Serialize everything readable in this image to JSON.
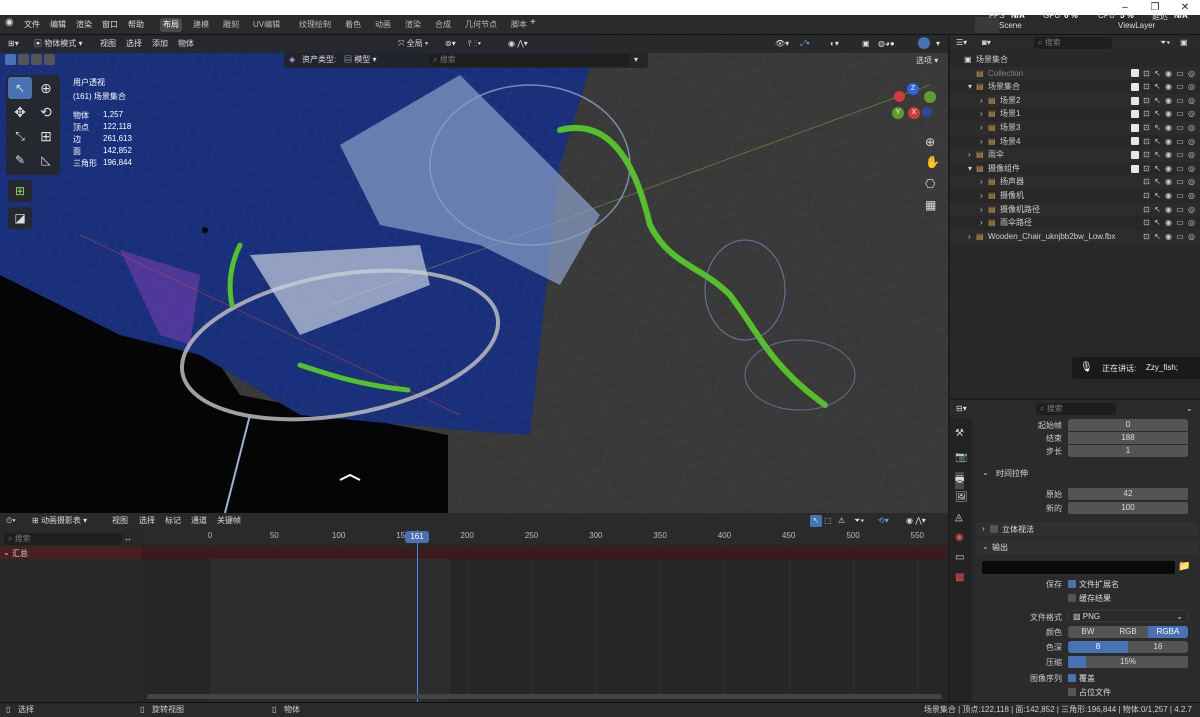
{
  "os_bar": {
    "logo_icon": "blender-logo-icon",
    "menus": [
      "文件",
      "编辑",
      "渲染",
      "窗口",
      "帮助"
    ],
    "fps_label": "FPS",
    "fps_value": "N/A",
    "gpu_label": "GPU",
    "gpu_value": "6 %",
    "cpu_label": "CPU",
    "cpu_value": "5 %",
    "delay_label": "延迟",
    "delay_value": "N/A",
    "scene_name": "Scene",
    "view_layer": "ViewLayer"
  },
  "workspace_tabs": [
    "布局",
    "建模",
    "雕刻",
    "UV编辑",
    "纹理绘制",
    "着色",
    "动画",
    "渲染",
    "合成",
    "几何节点",
    "脚本"
  ],
  "active_tab": "布局",
  "viewport_header": {
    "mode": "物体模式",
    "menus": [
      "视图",
      "选择",
      "添加",
      "物体"
    ],
    "transform": "全局",
    "asset_type_label": "资产类型:",
    "asset_type_value": "模型",
    "search_placeholder": "搜索",
    "options_label": "选项"
  },
  "viewport_info": {
    "view_name": "用户透视",
    "collection": "(161) 场景集合",
    "stats": [
      {
        "label": "物体",
        "value": "1,257"
      },
      {
        "label": "顶点",
        "value": "122,118"
      },
      {
        "label": "边",
        "value": "261,613"
      },
      {
        "label": "面",
        "value": "142,852"
      },
      {
        "label": "三角形",
        "value": "196,844"
      }
    ]
  },
  "gizmo": {
    "z": "Z",
    "y": "Y",
    "x": "X"
  },
  "outliner": {
    "search_placeholder": "搜索",
    "rows": [
      {
        "label": "场景集合",
        "indent": 0,
        "arrow": "",
        "checked": false
      },
      {
        "label": "Collection",
        "indent": 1,
        "arrow": "",
        "checked": true,
        "dim": true
      },
      {
        "label": "场景集合",
        "indent": 1,
        "arrow": "▾",
        "checked": true
      },
      {
        "label": "场景2",
        "indent": 2,
        "arrow": "›",
        "checked": true
      },
      {
        "label": "场景1",
        "indent": 2,
        "arrow": "›",
        "checked": true
      },
      {
        "label": "场景3",
        "indent": 2,
        "arrow": "›",
        "checked": true
      },
      {
        "label": "场景4",
        "indent": 2,
        "arrow": "›",
        "checked": true
      },
      {
        "label": "雨伞",
        "indent": 1,
        "arrow": "›",
        "checked": true
      },
      {
        "label": "摄像组件",
        "indent": 1,
        "arrow": "▾",
        "checked": true
      },
      {
        "label": "扬声器",
        "indent": 2,
        "arrow": "›",
        "checked": false
      },
      {
        "label": "摄像机",
        "indent": 2,
        "arrow": "›",
        "checked": false
      },
      {
        "label": "摄像机路径",
        "indent": 2,
        "arrow": "›",
        "checked": false
      },
      {
        "label": "雨伞路径",
        "indent": 2,
        "arrow": "›",
        "checked": false
      },
      {
        "label": "Wooden_Chair_uknjbb2bw_Low.fbx",
        "indent": 1,
        "arrow": "›",
        "checked": false
      }
    ]
  },
  "speaking": {
    "label": "正在讲话:",
    "name": "Zzy_fish;"
  },
  "properties": {
    "search_placeholder": "搜索",
    "frame_start_label": "起始帧",
    "frame_start": "0",
    "frame_end_label": "结束",
    "frame_end": "188",
    "frame_step_label": "步长",
    "frame_step": "1",
    "time_stretch_title": "时间拉伸",
    "old_label": "原始",
    "old_value": "42",
    "new_label": "新的",
    "new_value": "100",
    "stereo_title": "立体视法",
    "output_title": "输出",
    "save_label": "保存",
    "file_ext_label": "文件扩展名",
    "cache_label": "缓存结果",
    "file_format_label": "文件格式",
    "file_format_value": "PNG",
    "color_label": "颜色",
    "color_opts": [
      "BW",
      "RGB",
      "RGBA"
    ],
    "color_active": "RGBA",
    "depth_label": "色深",
    "depth_opts": [
      "8",
      "16"
    ],
    "depth_active": "8",
    "compress_label": "压缩",
    "compress_value": "15%",
    "compress_fraction": 0.15,
    "image_seq_label": "图像序列",
    "overwrite_label": "覆盖",
    "placeholder_label": "占位文件"
  },
  "dopesheet": {
    "mode": "动画摄影表",
    "menus": [
      "视图",
      "选择",
      "标记",
      "通道",
      "关键帧"
    ],
    "search_placeholder": "搜索",
    "summary_label": "汇总",
    "ticks": [
      "0",
      "50",
      "100",
      "150",
      "200",
      "250",
      "300",
      "350",
      "400",
      "450",
      "500",
      "550"
    ],
    "current_frame": "161"
  },
  "status_bar": {
    "left_items": [
      "选择",
      "旋转视图",
      "物体"
    ],
    "right_text": "场景集合 | 顶点:122,118 | 面:142,852 | 三角形:196,844 | 物体:0/1,257 | 4.2.7"
  },
  "colors": {
    "accent": "#4772b3",
    "green_ribbon": "#54c02a",
    "dark_blue_plane": "#1a2f7a"
  }
}
